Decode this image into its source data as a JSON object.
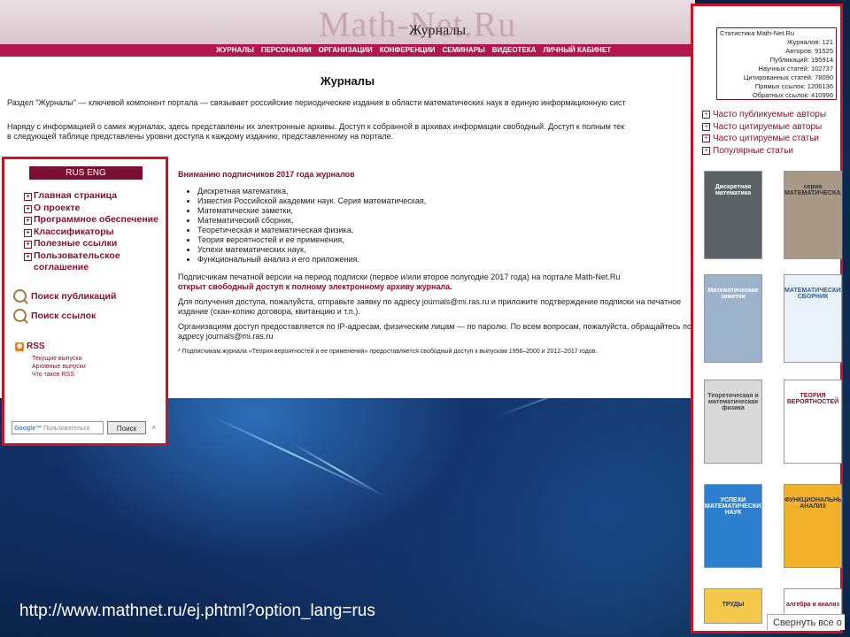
{
  "site": {
    "logo": "Math-Net.Ru",
    "section": "Журналы"
  },
  "nav": [
    "ЖУРНАЛЫ",
    "ПЕРСОНАЛИИ",
    "ОРГАНИЗАЦИИ",
    "КОНФЕРЕНЦИИ",
    "СЕМИНАРЫ",
    "ВИДЕОТЕКА",
    "ЛИЧНЫЙ КАБИНЕТ"
  ],
  "main": {
    "heading": "Журналы",
    "intro1": "Раздел \"Журналы\" — ключевой компонент портала — связывает российские периодические издания в области математических наук в единую информационную сист",
    "intro2": "Наряду с информацией о самих журналах, здесь представлены их электронные архивы. Доступ к собранной в архивах информации свободный. Доступ к полным тек",
    "intro3": "в следующей таблице представлены уровни доступа к каждому изданию, представленному на портале."
  },
  "sidebar": {
    "lang": "RUS  ENG",
    "menu": [
      "Главная страница",
      "О проекте",
      "Программное обеспечение",
      "Классификаторы",
      "Полезные ссылки",
      "Пользовательское соглашение"
    ],
    "search_pubs": "Поиск публикаций",
    "search_refs": "Поиск ссылок",
    "rss": "RSS",
    "rss_links": [
      "Текущие выпуски",
      "Архивные выпуски",
      "Что такое RSS"
    ],
    "google_placeholder": "Пользовательск",
    "google_button": "Поиск",
    "close": "×"
  },
  "notice": {
    "title": "Вниманию подписчиков 2017 года журналов",
    "journals": [
      "Дискретная математика,",
      "Известия Российской академии наук. Серия математическая,",
      "Математические заметки,",
      "Математический сборник,",
      "Теоретическая и математическая физика,",
      "Теория вероятностей и ее применения,",
      "Успехи математических наук,",
      "Функциональный анализ и его приложения."
    ],
    "p1": "Подписчикам печатной версии на период подписки (первое и/или второе полугодие 2017 года) на портале Math-Net.Ru",
    "p1_red": "открыт свободный доступ к полному электронному архиву журнала.",
    "p2": "Для получения доступа, пожалуйста, отправьте заявку по адресу journals@mi.ras.ru и приложите подтверждение подписки на печатное издание (скан-копию договора, квитанцию и т.п.).",
    "p3": "Организациям доступ предоставляется по IP-адресам, физическим лицам — по паролю. По всем вопросам, пожалуйста, обращайтесь по адресу journals@mi.ras.ru",
    "footnote": "* Подписчикам журнала «Теория вероятностей и ее применения» предоставляется свободный доступ к выпускам 1956–2000 и 2012–2017 годов."
  },
  "stats": {
    "title": "Статистика Math-Net.Ru",
    "rows": [
      "Журналов: 121",
      "Авторов: 91525",
      "Публикаций: 195914",
      "Научных статей: 102737",
      "Цитированных статей: 78090",
      "Прямых ссылок: 1206136",
      "Обратных ссылок: 410996"
    ]
  },
  "quick_links": [
    "Часто публикуемые авторы",
    "Часто цитируемые авторы",
    "Часто цитируемые статьи",
    "Популярные статьи"
  ],
  "covers": [
    {
      "text": "Дискретная математика",
      "color": "#5a6266",
      "fg": "#ffffff"
    },
    {
      "text": "серия МАТЕМАТИЧЕСКАЯ",
      "color": "#a89986",
      "fg": "#333333"
    },
    {
      "text": "Математические заметки",
      "color": "#9db3cc",
      "fg": "#ffffff"
    },
    {
      "text": "МАТЕМАТИЧЕСКИЙ СБОРНИК",
      "color": "#e9f2fb",
      "fg": "#2a5f9a"
    },
    {
      "text": "Теоретическая и математическая физика",
      "color": "#d9d9d9",
      "fg": "#444444"
    },
    {
      "text": "ТЕОРИЯ ВЕРОЯТНОСТЕЙ",
      "color": "#ffffff",
      "fg": "#8a0f2e"
    },
    {
      "text": "УСПЕХИ МАТЕМАТИЧЕСКИХ НАУК",
      "color": "#2d7fd0",
      "fg": "#ffffff"
    },
    {
      "text": "ФУНКЦИОНАЛЬНЫЙ АНАЛИЗ",
      "color": "#f2b12a",
      "fg": "#333333"
    },
    {
      "text": "ТРУДЫ",
      "color": "#f4c84a",
      "fg": "#333333"
    },
    {
      "text": "алгебра и анализ",
      "color": "#ffffff",
      "fg": "#8a0f2e"
    }
  ],
  "url": "http://www.mathnet.ru/ej.phtml?option_lang=rus",
  "collapse": "Свернуть все о"
}
